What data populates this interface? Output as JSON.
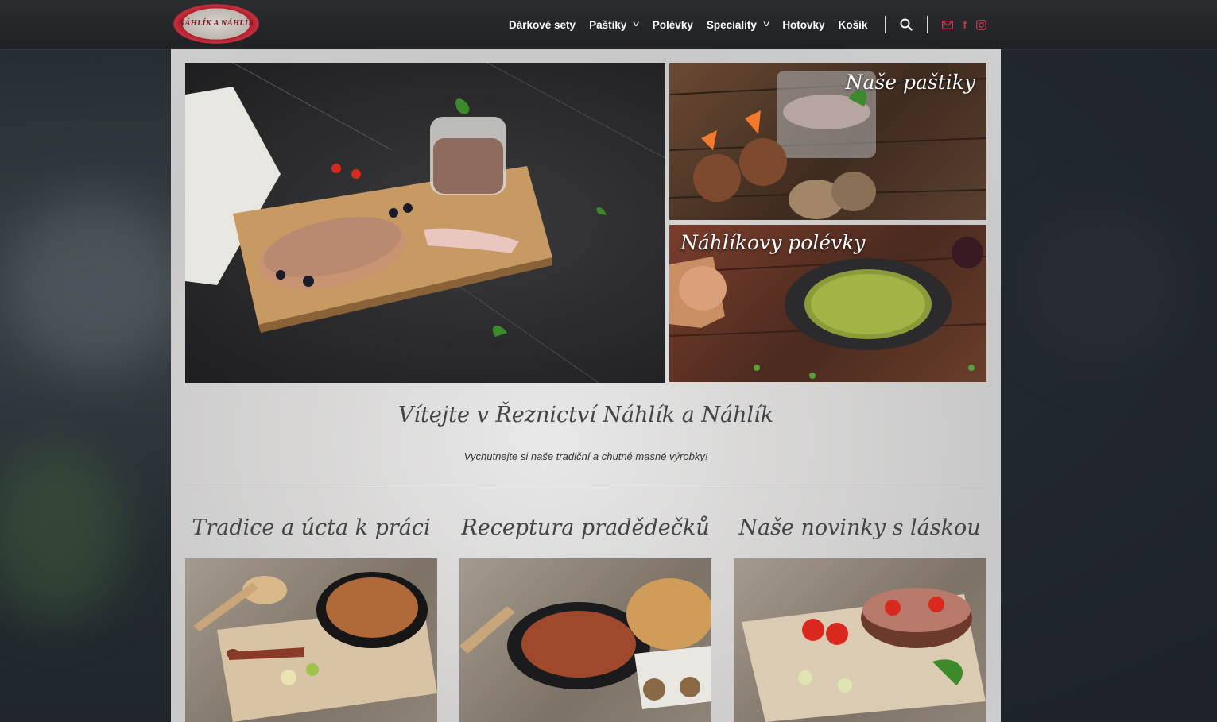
{
  "brand": {
    "logo_text": "NÁHLÍK A NÁHLÍK"
  },
  "nav": {
    "items": [
      {
        "label": "Dárkové sety",
        "dropdown": false
      },
      {
        "label": "Paštiky",
        "dropdown": true
      },
      {
        "label": "Polévky",
        "dropdown": false
      },
      {
        "label": "Speciality",
        "dropdown": true
      },
      {
        "label": "Hotovky",
        "dropdown": false
      },
      {
        "label": "Košík",
        "dropdown": false
      }
    ],
    "icons": [
      "search-icon",
      "envelope-icon",
      "facebook-icon",
      "instagram-icon"
    ],
    "accent_color": "#c0394a"
  },
  "hero": {
    "caption_pastiky": "Naše paštiky",
    "caption_polevky": "Náhlíkovy polévky"
  },
  "welcome": {
    "title": "Vítejte v Řeznictví Náhlík a Náhlík",
    "subtitle": "Vychutnejte si naše tradiční a chutné masné výrobky!"
  },
  "columns": [
    {
      "title": "Tradice a úcta k práci"
    },
    {
      "title": "Receptura pradědečků"
    },
    {
      "title": "Naše novinky s láskou"
    }
  ]
}
